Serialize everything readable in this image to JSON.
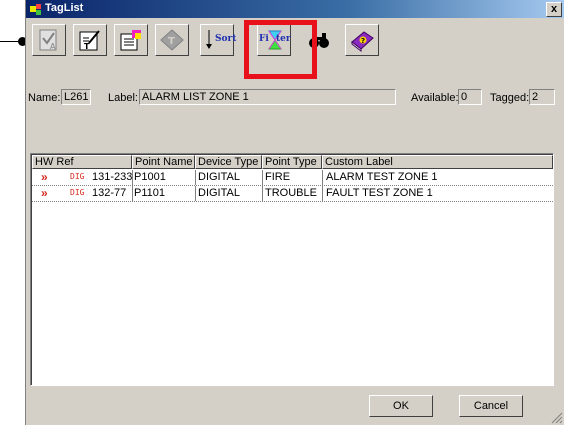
{
  "window": {
    "title": "TagList",
    "close_symbol": "x"
  },
  "toolbar": {
    "sort_label": "Sort",
    "filter_label_prefix": "Fi",
    "filter_label_suffix": "ter"
  },
  "info": {
    "name_label": "Name:",
    "name_value": "L261",
    "label_label": "Label:",
    "label_value": "ALARM LIST ZONE 1",
    "available_label": "Available:",
    "available_value": "0",
    "tagged_label": "Tagged:",
    "tagged_value": "2"
  },
  "table": {
    "columns": [
      "HW Ref",
      "Point Name",
      "Device Type",
      "Point Type",
      "Custom Label"
    ],
    "rows": [
      {
        "marker": "»",
        "hw_tag": "DIG",
        "hw_ref": "131-233",
        "point_name": "P1001",
        "device_type": "DIGITAL",
        "point_type": "FIRE",
        "custom_label": "ALARM TEST ZONE 1"
      },
      {
        "marker": "»",
        "hw_tag": "DIG",
        "hw_ref": "132-77",
        "point_name": "P1101",
        "device_type": "DIGITAL",
        "point_type": "TROUBLE",
        "custom_label": "FAULT TEST ZONE 1"
      }
    ]
  },
  "buttons": {
    "ok": "OK",
    "cancel": "Cancel"
  },
  "colors": {
    "highlight": "#e8101a",
    "title_bar": "#0a246a",
    "marker": "#d42b1e"
  }
}
